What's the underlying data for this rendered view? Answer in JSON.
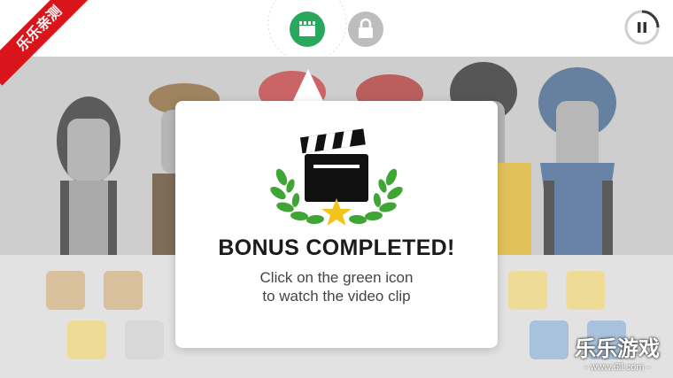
{
  "ribbon": {
    "text": "乐乐亲测"
  },
  "topbar": {
    "video_icon_color": "#27a85b",
    "lock_icon_color": "#bdbdbd",
    "pause_icon": "pause-icon"
  },
  "dialog": {
    "title": "BONUS COMPLETED!",
    "message_line1": "Click on the green icon",
    "message_line2": "to watch the video clip",
    "icon": "clapperboard-laurel-icon",
    "laurel_color": "#3fa535",
    "star_color": "#f2c31b"
  },
  "watermark": {
    "title": "乐乐游戏",
    "url": "- www.6ll.com -"
  }
}
